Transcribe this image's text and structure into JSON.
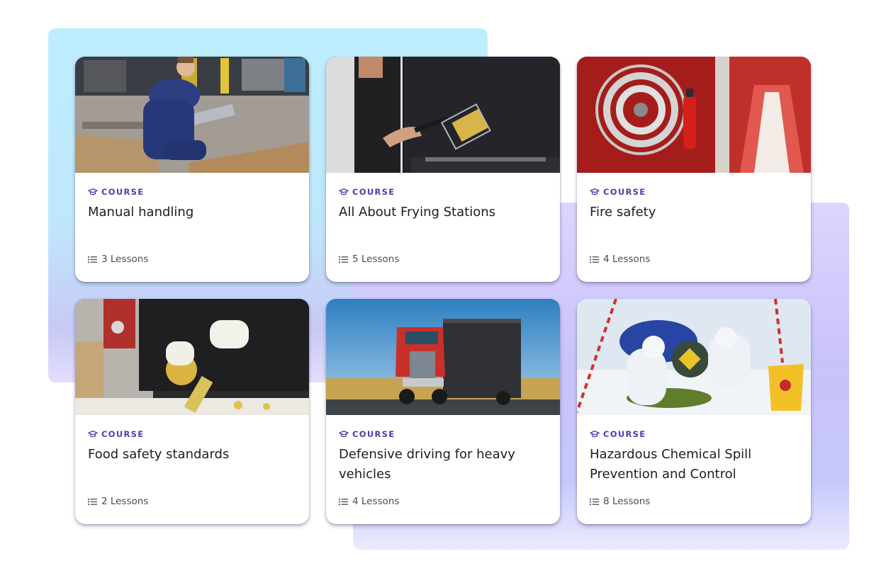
{
  "courses": [
    {
      "type_label": "COURSE",
      "title": "Manual handling",
      "lessons": "3 Lessons",
      "thumbnail": "warehouse-worker-lifting-image"
    },
    {
      "type_label": "COURSE",
      "title": "All About Frying Stations",
      "lessons": "5 Lessons",
      "thumbnail": "chef-fryer-basket-image"
    },
    {
      "type_label": "COURSE",
      "title": "Fire safety",
      "lessons": "4 Lessons",
      "thumbnail": "fire-hose-reel-corridor-image"
    },
    {
      "type_label": "COURSE",
      "title": "Food safety standards",
      "lessons": "2 Lessons",
      "thumbnail": "gloved-hands-grating-food-image"
    },
    {
      "type_label": "COURSE",
      "title": "Defensive driving for heavy vehicles",
      "lessons": "4 Lessons",
      "thumbnail": "red-semi-truck-road-image"
    },
    {
      "type_label": "COURSE",
      "title": "Hazardous Chemical Spill Prevention and Control",
      "lessons": "8 Lessons",
      "thumbnail": "hazmat-spill-cleanup-image"
    }
  ],
  "icons": {
    "course_tag": "graduation-cap-icon",
    "lessons_count": "list-icon"
  },
  "colors": {
    "accent": "#4a3fb3",
    "card_background": "#ffffff",
    "backdrop_cyan": "#bdeefd",
    "backdrop_purple": "#c9c3fb"
  }
}
